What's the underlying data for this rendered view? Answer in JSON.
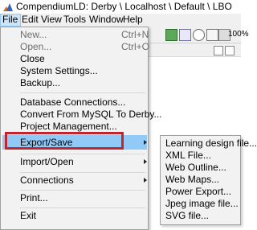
{
  "window": {
    "title": "CompendiumLD: Derby \\ Localhost \\ Default \\ LBO"
  },
  "menubar": {
    "items": [
      "File",
      "Edit",
      "View",
      "Tools",
      "Window",
      "Help"
    ]
  },
  "toolbar": {
    "zoom_label": "100%"
  },
  "file_menu": {
    "items": [
      {
        "label": "New...",
        "shortcut": "Ctrl+N",
        "enabled": false
      },
      {
        "label": "Open...",
        "shortcut": "Ctrl+O",
        "enabled": false
      },
      {
        "label": "Close",
        "shortcut": "",
        "enabled": true
      },
      {
        "label": "System Settings...",
        "shortcut": "",
        "enabled": true
      },
      {
        "label": "Backup...",
        "shortcut": "",
        "enabled": true
      },
      {
        "label": "Database Connections...",
        "shortcut": "",
        "enabled": true
      },
      {
        "label": "Convert From MySQL To Derby...",
        "shortcut": "",
        "enabled": true
      },
      {
        "label": "Project Management...",
        "shortcut": "",
        "enabled": true
      },
      {
        "label": "Export/Save",
        "shortcut": "",
        "enabled": true,
        "submenu": true,
        "highlighted": true
      },
      {
        "label": "Import/Open",
        "shortcut": "",
        "enabled": true,
        "submenu": true
      },
      {
        "label": "Connections",
        "shortcut": "",
        "enabled": true,
        "submenu": true
      },
      {
        "label": "Print...",
        "shortcut": "",
        "enabled": true
      },
      {
        "label": "Exit",
        "shortcut": "",
        "enabled": true
      }
    ]
  },
  "export_submenu": {
    "items": [
      "Learning design file...",
      "XML File...",
      "Web Outline...",
      "Web Maps...",
      "Power Export...",
      "Jpeg image file...",
      "SVG file..."
    ]
  },
  "colors": {
    "highlight": "#91c9f7",
    "annotation_box": "#c0262d",
    "menu_bg": "#f2f2f2"
  }
}
